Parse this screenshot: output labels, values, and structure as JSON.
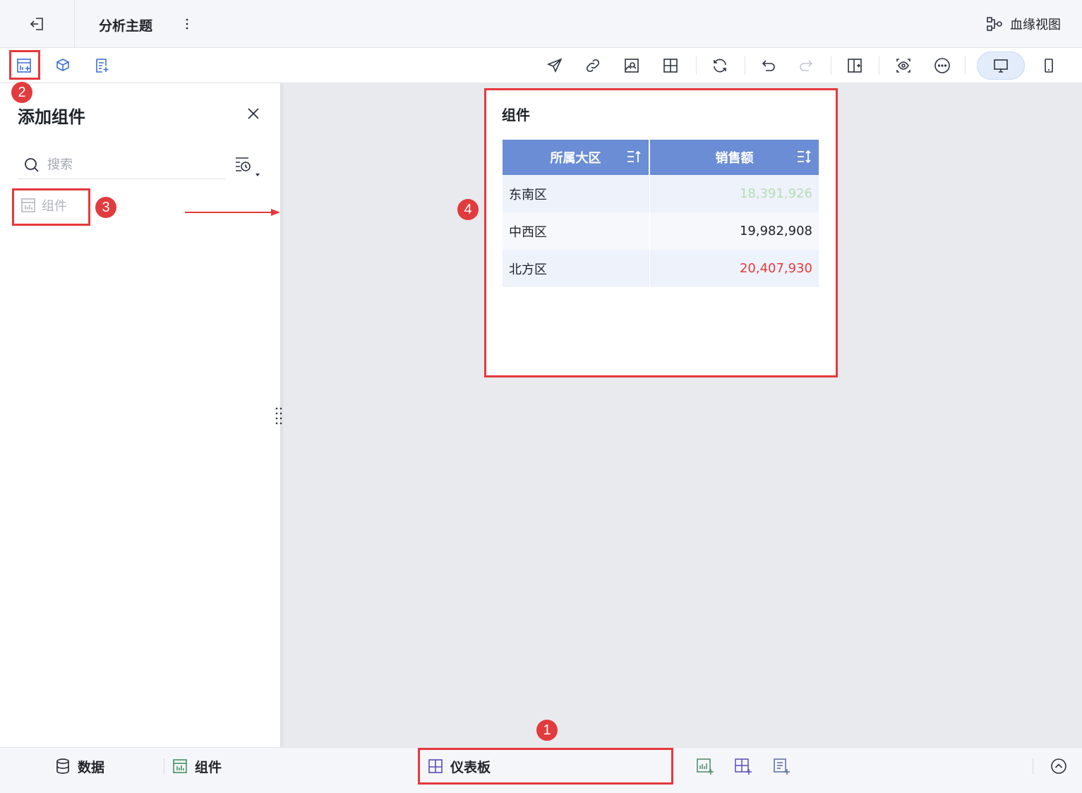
{
  "header": {
    "title": "分析主题",
    "lineage_label": "血缘视图"
  },
  "left_panel": {
    "title": "添加组件",
    "search_placeholder": "搜索",
    "items": [
      {
        "label": "组件"
      }
    ]
  },
  "widget": {
    "title": "组件",
    "columns": [
      "所属大区",
      "销售额"
    ],
    "rows": [
      {
        "region": "东南区",
        "sales": "18,391,926",
        "color": "#b6dcb5"
      },
      {
        "region": "中西区",
        "sales": "19,982,908",
        "color": "#1f2329"
      },
      {
        "region": "北方区",
        "sales": "20,407,930",
        "color": "#e23b3e"
      }
    ]
  },
  "bottom": {
    "data_tab": "数据",
    "component_tab": "组件",
    "dashboard_tab": "仪表板"
  },
  "annotations": {
    "b1": "1",
    "b2": "2",
    "b3": "3",
    "b4": "4"
  },
  "colors": {
    "accent": "#6b8dd6",
    "annotation": "#e5393c"
  }
}
